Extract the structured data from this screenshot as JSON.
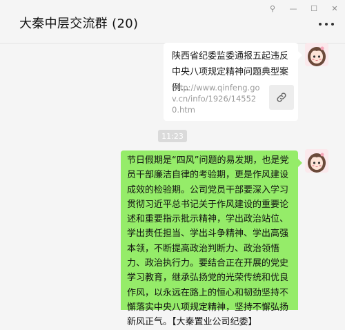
{
  "window": {
    "title": "大秦中层交流群 (20)",
    "buttons": {
      "pin": "⚲",
      "minimize": "—",
      "maximize": "☐",
      "close": "✕"
    }
  },
  "messages": {
    "link_card": {
      "title": "陕西省纪委监委通报五起违反中央八项规定精神问题典型案例...",
      "url": "http://www.qinfeng.gov.cn/info/1926/145520.htm",
      "icon": "link-icon"
    },
    "timestamp": "11:23",
    "text_message": {
      "text": "节日假期是“四风”问题的易发期，也是党员干部廉洁自律的考验期，更是作风建设成效的检验期。公司党员干部要深入学习贯彻习近平总书记关于作风建设的重要论述和重要指示批示精神，学出政治站位、学出责任担当、学出斗争精神、学出高强本领，不断提高政治判断力、政治领悟力、政治执行力。要结合正在开展的党史学习教育，继承弘扬党的光荣传统和优良作风，以永远在路上的恒心和韧劲坚持不懈落实中央八项规定精神，坚持不懈弘扬新风正气。【大秦置业公司纪委】",
      "bubble_color": "#95ec69"
    }
  },
  "colors": {
    "background": "#f5f5f5",
    "bubble_self": "#95ec69",
    "bubble_link": "#ffffff",
    "time_bg": "#dadada"
  }
}
